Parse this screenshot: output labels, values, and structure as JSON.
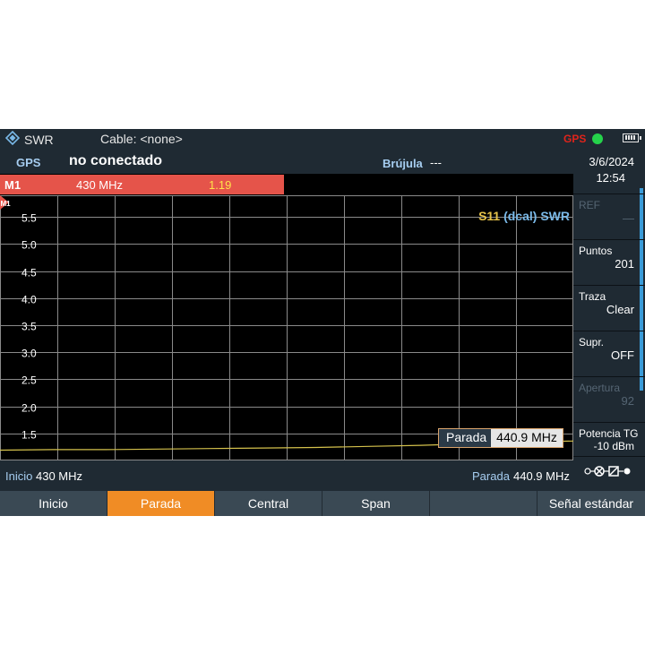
{
  "title_bar": {
    "mode": "SWR",
    "cable": "Cable: <none>",
    "gps_indicator": "GPS",
    "colors": {
      "gps_indicator": "#e0241b",
      "gps_status_dot": "#25d34b"
    }
  },
  "status_row": {
    "gps_label": "GPS",
    "gps_value": "no conectado",
    "compass_label": "Brújula",
    "compass_value": "---"
  },
  "marker": {
    "name": "M1",
    "frequency": "430 MHz",
    "value": "1.19",
    "color": "#e5544a"
  },
  "chart_data": {
    "type": "line",
    "trace_label": {
      "param": "S11",
      "cal": "(dcal)",
      "format": "SWR"
    },
    "y_tick_labels": [
      "5.5",
      "5.0",
      "4.5",
      "4.0",
      "3.5",
      "3.0",
      "2.5",
      "2.0",
      "1.5"
    ],
    "ylim": [
      1.0,
      5.9
    ],
    "xlim": [
      430,
      440.9
    ],
    "grid": true,
    "trace_color": "#d4c14c",
    "series": [
      {
        "x": [
          430,
          431,
          432,
          433,
          434,
          435,
          436,
          437,
          438,
          439,
          440,
          440.9
        ],
        "values": [
          1.19,
          1.2,
          1.2,
          1.21,
          1.22,
          1.23,
          1.24,
          1.26,
          1.28,
          1.31,
          1.34,
          1.36
        ]
      }
    ]
  },
  "stop_marker_box": {
    "label": "Parada",
    "value": "440.9 MHz"
  },
  "frequency_row": {
    "start_label": "Inicio",
    "start_value": "430 MHz",
    "stop_label": "Parada",
    "stop_value": "440.9 MHz"
  },
  "side_panel": {
    "date": "3/6/2024",
    "time": "12:54",
    "softkeys": [
      {
        "label": "REF",
        "value": "—",
        "enabled": false
      },
      {
        "label": "Puntos",
        "value": "201",
        "enabled": true
      },
      {
        "label": "Traza",
        "value": "Clear",
        "enabled": true
      },
      {
        "label": "Supr.",
        "value": "OFF",
        "enabled": true
      },
      {
        "label": "Apertura",
        "value": "92",
        "enabled": false
      },
      {
        "label": "Potencia TG",
        "value": "-10 dBm",
        "enabled": true
      }
    ],
    "bottom_icon": "port-connection-icon"
  },
  "softkey_bar": {
    "buttons": [
      {
        "label": "Inicio",
        "active": false
      },
      {
        "label": "Parada",
        "active": true
      },
      {
        "label": "Central",
        "active": false
      },
      {
        "label": "Span",
        "active": false
      },
      {
        "label": "",
        "active": false
      },
      {
        "label": "Señal estándar",
        "active": false
      }
    ],
    "active_color": "#f08c25"
  }
}
